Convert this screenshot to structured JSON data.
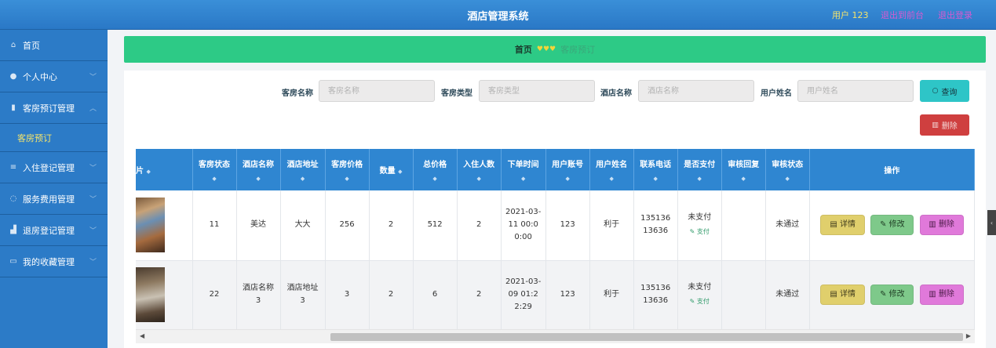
{
  "header": {
    "title": "酒店管理系统",
    "user": "用户 123",
    "back_link": "退出到前台",
    "logout_link": "退出登录"
  },
  "sidebar": {
    "items": [
      {
        "label": "首页",
        "icon": "home-icon"
      },
      {
        "label": "个人中心",
        "icon": "user-icon"
      },
      {
        "label": "客房预订管理",
        "icon": "bar-chart-icon"
      },
      {
        "label": "客房预订",
        "icon": ""
      },
      {
        "label": "入住登记管理",
        "icon": "list-icon"
      },
      {
        "label": "服务费用管理",
        "icon": "circle-icon"
      },
      {
        "label": "退房登记管理",
        "icon": "chart-icon"
      },
      {
        "label": "我的收藏管理",
        "icon": "chat-icon"
      }
    ],
    "active_sub": "客房预订"
  },
  "breadcrumb": {
    "home": "首页",
    "current": "客房预订"
  },
  "filters": {
    "room_name_label": "客房名称",
    "room_name_placeholder": "客房名称",
    "room_type_label": "客房类型",
    "room_type_placeholder": "客房类型",
    "hotel_name_label": "酒店名称",
    "hotel_name_placeholder": "酒店名称",
    "user_name_label": "用户姓名",
    "user_name_placeholder": "用户姓名",
    "search_label": "查询",
    "delete_label": "删除"
  },
  "table": {
    "columns": [
      "片",
      "客房状态",
      "酒店名称",
      "酒店地址",
      "客房价格",
      "数量",
      "总价格",
      "入住人数",
      "下单时间",
      "用户账号",
      "用户姓名",
      "联系电话",
      "是否支付",
      "审核回复",
      "审核状态",
      "操作"
    ],
    "rows": [
      {
        "room_status": "11",
        "hotel_name": "美达",
        "hotel_address": "大大",
        "room_price": "256",
        "quantity": "2",
        "total_price": "512",
        "guests": "2",
        "order_time": "2021-03-11 00:00:00",
        "account": "123",
        "user_name": "利于",
        "phone": "13513613636",
        "paid": "未支付",
        "pay_action": "支付",
        "review_reply": "",
        "review_status": "未通过"
      },
      {
        "room_status": "22",
        "hotel_name": "酒店名称3",
        "hotel_address": "酒店地址3",
        "room_price": "3",
        "quantity": "2",
        "total_price": "6",
        "guests": "2",
        "order_time": "2021-03-09 01:22:29",
        "account": "123",
        "user_name": "利于",
        "phone": "13513613636",
        "paid": "未支付",
        "pay_action": "支付",
        "review_reply": "",
        "review_status": "未通过"
      }
    ],
    "actions": {
      "detail": "详情",
      "edit": "修改",
      "delete": "删除"
    }
  },
  "colors": {
    "topbar": "#2a78c6",
    "sidebar": "#2c7bc7",
    "breadcrumb_bg": "#2dca86",
    "header_cell": "#2f86d1",
    "search_btn": "#2ec5c7",
    "delete_btn": "#cf3f3f",
    "detail_btn": "#e0cf6c",
    "edit_btn": "#7ec98a",
    "row_delete_btn": "#e079da"
  }
}
